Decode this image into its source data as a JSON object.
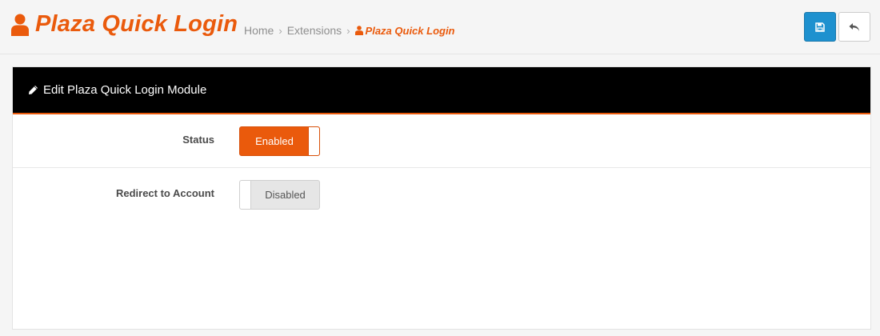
{
  "header": {
    "title": "Plaza Quick Login",
    "title_icon": "user-icon",
    "brand_color": "#ea5a0c"
  },
  "breadcrumb": {
    "items": [
      "Home",
      "Extensions"
    ],
    "separator": "›",
    "active": "Plaza Quick Login",
    "active_icon": "user-icon"
  },
  "toolbar": {
    "save_icon": "floppy-disk-icon",
    "save_color": "#1e91cf",
    "back_icon": "reply-arrow-icon"
  },
  "panel": {
    "title": "Edit Plaza Quick Login Module",
    "title_icon": "pencil-icon",
    "heading_background": "#000000",
    "heading_accent": "#ea5a0c"
  },
  "form": {
    "fields": [
      {
        "label": "Status",
        "value": "Enabled",
        "enabled": true
      },
      {
        "label": "Redirect to Account",
        "value": "Disabled",
        "enabled": false
      }
    ]
  }
}
